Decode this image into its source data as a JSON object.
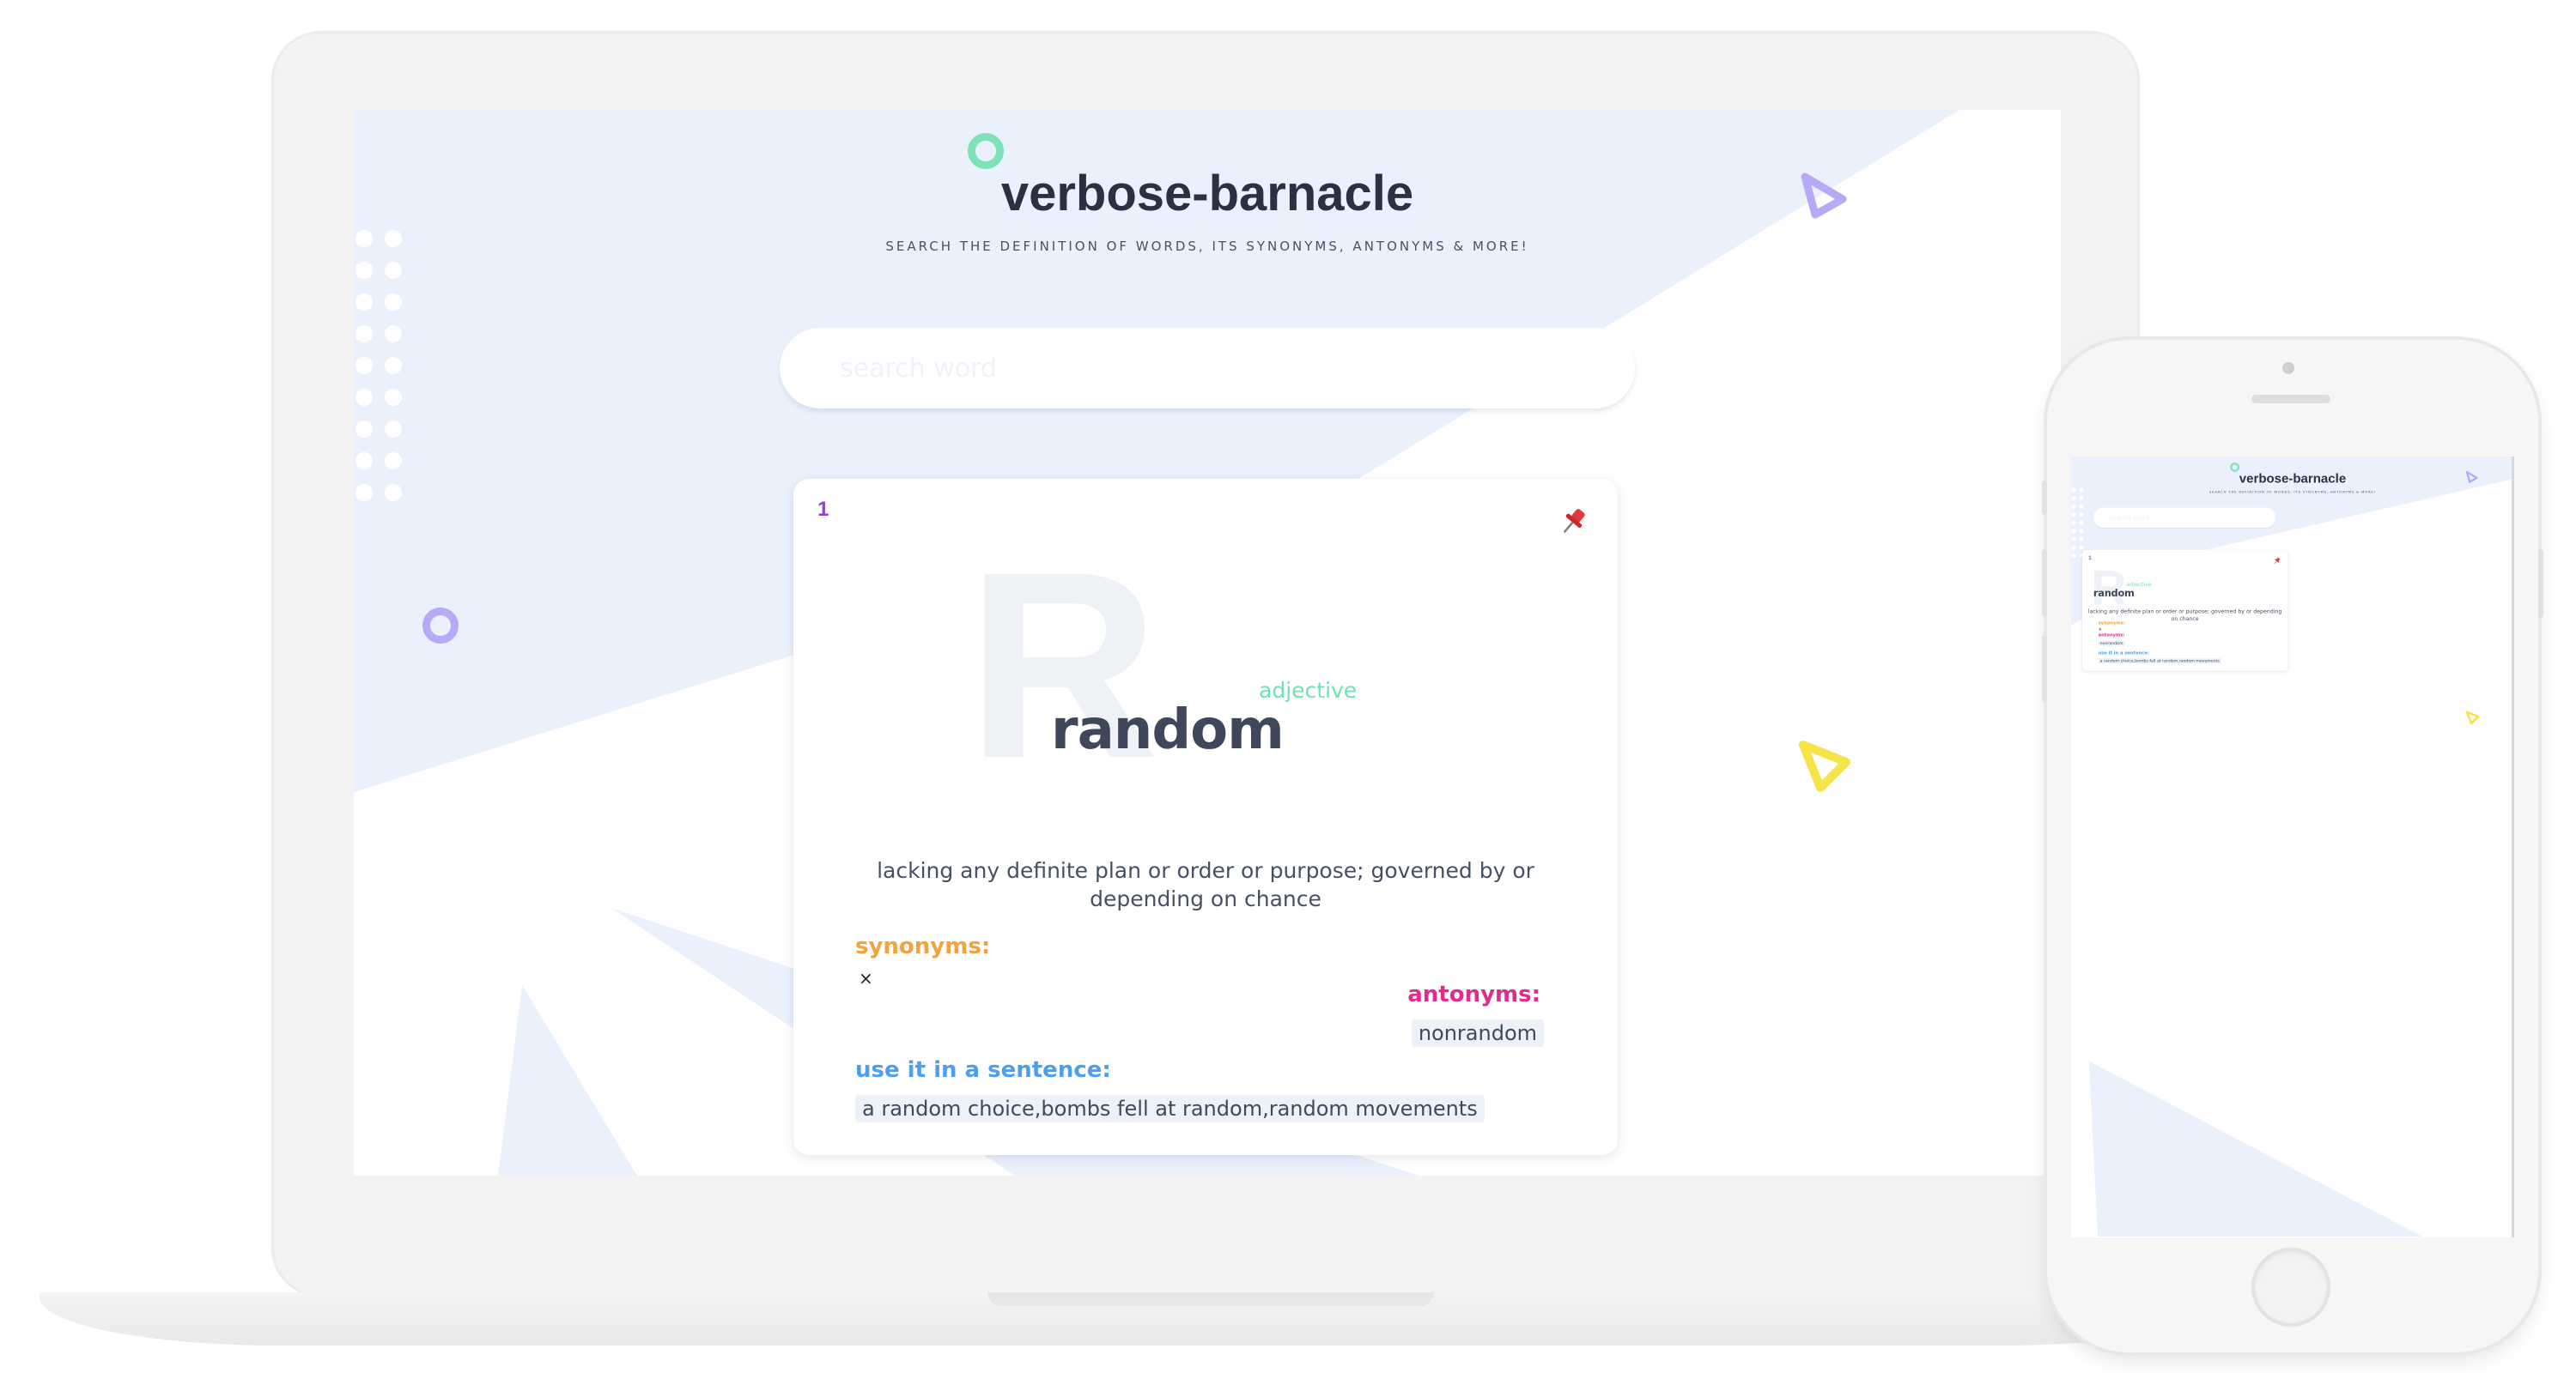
{
  "app": {
    "title": "verbose-barnacle",
    "subtitle": "SEARCH THE DEFINITION OF WORDS, ITS SYNONYMS, ANTONYMS & MORE!",
    "search_placeholder": "search word"
  },
  "result": {
    "index": "1",
    "big_letter": "R",
    "word": "random",
    "part_of_speech": "adjective",
    "definition": "lacking any definite plan or order or purpose; governed by or depending on chance",
    "synonyms_label": "synonyms:",
    "synonyms_value": "×",
    "antonyms_label": "antonyms:",
    "antonyms_value": "nonrandom",
    "sentence_label": "use it in a sentence:",
    "sentence_value": "a random choice,bombs fell at random,random movements"
  },
  "icons": {
    "pin": "pushpin-icon",
    "remove": "close-icon"
  },
  "colors": {
    "background_shape": "#eaf1fd",
    "accent_green": "#7ee4b7",
    "accent_purple": "#b6a9f5",
    "accent_yellow": "#f6e44a",
    "index": "#8a45d0",
    "synonyms": "#f0a33e",
    "antonyms": "#e12b8f",
    "sentence": "#4f9ee9",
    "part_of_speech": "#6fe4b0"
  }
}
